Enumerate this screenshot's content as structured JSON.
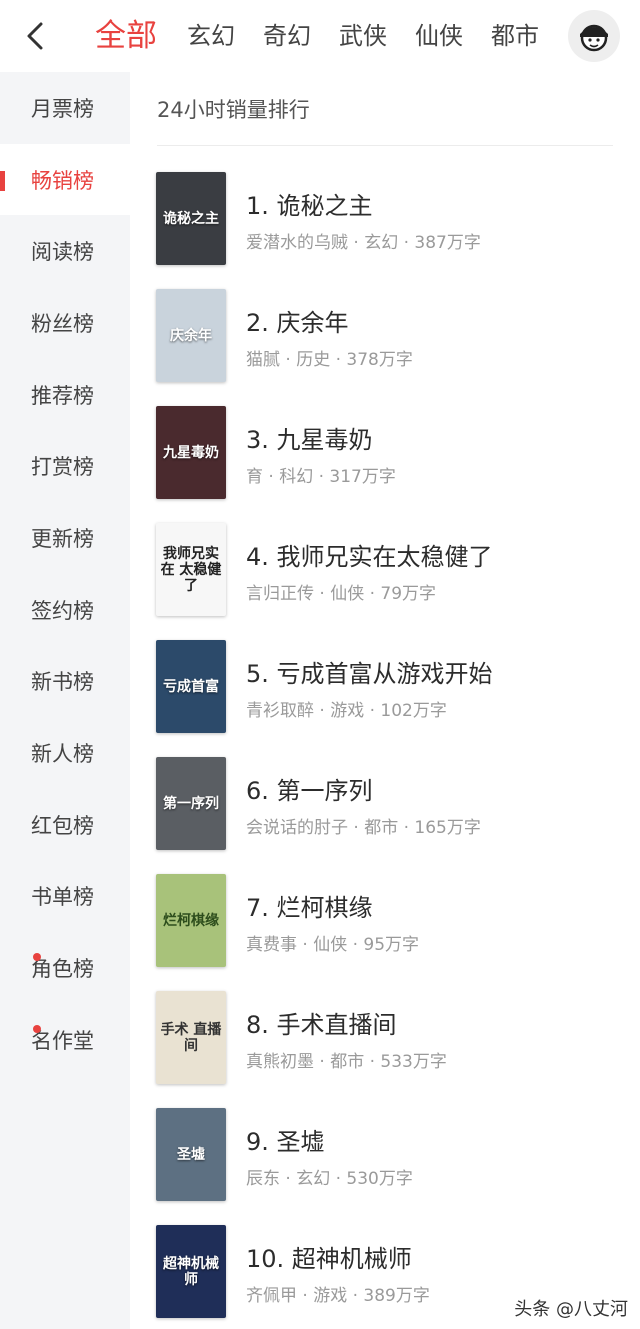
{
  "header": {
    "tabs": [
      "全部",
      "玄幻",
      "奇幻",
      "武侠",
      "仙侠",
      "都市"
    ]
  },
  "sidebar": {
    "items": [
      {
        "label": "月票榜",
        "active": false,
        "dot": false
      },
      {
        "label": "畅销榜",
        "active": true,
        "dot": false
      },
      {
        "label": "阅读榜",
        "active": false,
        "dot": false
      },
      {
        "label": "粉丝榜",
        "active": false,
        "dot": false
      },
      {
        "label": "推荐榜",
        "active": false,
        "dot": false
      },
      {
        "label": "打赏榜",
        "active": false,
        "dot": false
      },
      {
        "label": "更新榜",
        "active": false,
        "dot": false
      },
      {
        "label": "签约榜",
        "active": false,
        "dot": false
      },
      {
        "label": "新书榜",
        "active": false,
        "dot": false
      },
      {
        "label": "新人榜",
        "active": false,
        "dot": false
      },
      {
        "label": "红包榜",
        "active": false,
        "dot": false
      },
      {
        "label": "书单榜",
        "active": false,
        "dot": false
      },
      {
        "label": "角色榜",
        "active": false,
        "dot": true
      },
      {
        "label": "名作堂",
        "active": false,
        "dot": true
      }
    ]
  },
  "main": {
    "list_title": "24小时销量排行",
    "books": [
      {
        "title": "1. 诡秘之主",
        "meta": "爱潜水的乌贼 · 玄幻 · 387万字",
        "cover_text": "诡秘之主",
        "cover_bg": "#3a3d42"
      },
      {
        "title": "2. 庆余年",
        "meta": "猫腻 · 历史 · 378万字",
        "cover_text": "庆余年",
        "cover_bg": "#c9d3dc"
      },
      {
        "title": "3. 九星毒奶",
        "meta": "育 · 科幻 · 317万字",
        "cover_text": "九星毒奶",
        "cover_bg": "#4a2a2e"
      },
      {
        "title": "4. 我师兄实在太稳健了",
        "meta": "言归正传 · 仙侠 · 79万字",
        "cover_text": "我师兄实在 太稳健了",
        "cover_bg": "#f7f7f7"
      },
      {
        "title": "5. 亏成首富从游戏开始",
        "meta": "青衫取醉 · 游戏 · 102万字",
        "cover_text": "亏成首富",
        "cover_bg": "#2c4a6a"
      },
      {
        "title": "6. 第一序列",
        "meta": "会说话的肘子 · 都市 · 165万字",
        "cover_text": "第一序列",
        "cover_bg": "#5a5e63"
      },
      {
        "title": "7. 烂柯棋缘",
        "meta": "真费事 · 仙侠 · 95万字",
        "cover_text": "烂柯棋缘",
        "cover_bg": "#a8c27a"
      },
      {
        "title": "8. 手术直播间",
        "meta": "真熊初墨 · 都市 · 533万字",
        "cover_text": "手术 直播间",
        "cover_bg": "#e9e2d2"
      },
      {
        "title": "9. 圣墟",
        "meta": "辰东 · 玄幻 · 530万字",
        "cover_text": "圣墟",
        "cover_bg": "#5d7082"
      },
      {
        "title": "10. 超神机械师",
        "meta": "齐佩甲 · 游戏 · 389万字",
        "cover_text": "超神机械师",
        "cover_bg": "#1f2e58"
      }
    ]
  },
  "watermark": "头条 @八丈河",
  "colors": {
    "accent": "#e8423f",
    "sidebar_bg": "#f4f5f7"
  },
  "icons": {
    "back": "chevron-left-icon",
    "avatar": "user-avatar-icon"
  }
}
